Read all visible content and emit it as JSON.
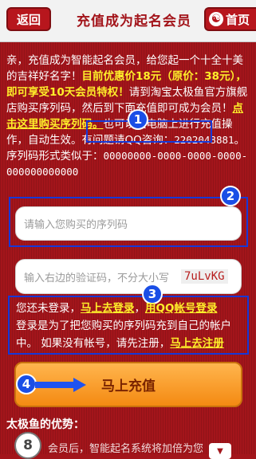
{
  "header": {
    "back_label": "返回",
    "title": "充值成为起名会员",
    "home_label": "首页",
    "home_icon": "yin-yang-icon"
  },
  "intro": {
    "text1": "亲，充值成为智能起名会员，给您起一个十全十美的吉祥好名字！",
    "promo": "目前优惠价18元（原价：38元），即可享受10天会员特权！",
    "text2": "请到淘宝太极鱼官方旗舰店购买序列码，然后到下面充值即可成为会员！",
    "buy_link": "点击这里购买序列码。",
    "text3": "也可以在电脑上进行充值操作，自动生效。有问题请QQ咨询：",
    "qq": "2202048881",
    "text4": "。序列码形式类似于：",
    "code_example": "00000000-0000-0000-0000-000000000000"
  },
  "form": {
    "serial_placeholder": "请输入您购买的序列码",
    "captcha_placeholder": "输入右边的验证码，不分大小写",
    "captcha_code": "7uLvKG"
  },
  "login": {
    "text1": "您还未登录，",
    "login_link": "马上去登录",
    "sep": "，",
    "qq_login_link": "用QQ帐号登录",
    "text2": "登录是为了把您购买的序列码充到自己的帐户中。  如果没有帐号，请先注册，",
    "register_link": "马上去注册"
  },
  "submit_label": "马上充值",
  "advantages": {
    "title": "太极鱼的优势：",
    "item1": "会员后，智能起名系统将加倍为您"
  },
  "badges": [
    "1",
    "2",
    "3",
    "4",
    "8"
  ],
  "colors": {
    "background": "#a3151b",
    "accent": "#ffef2a",
    "highlight": "#1638d8",
    "button": "#f48a12"
  }
}
